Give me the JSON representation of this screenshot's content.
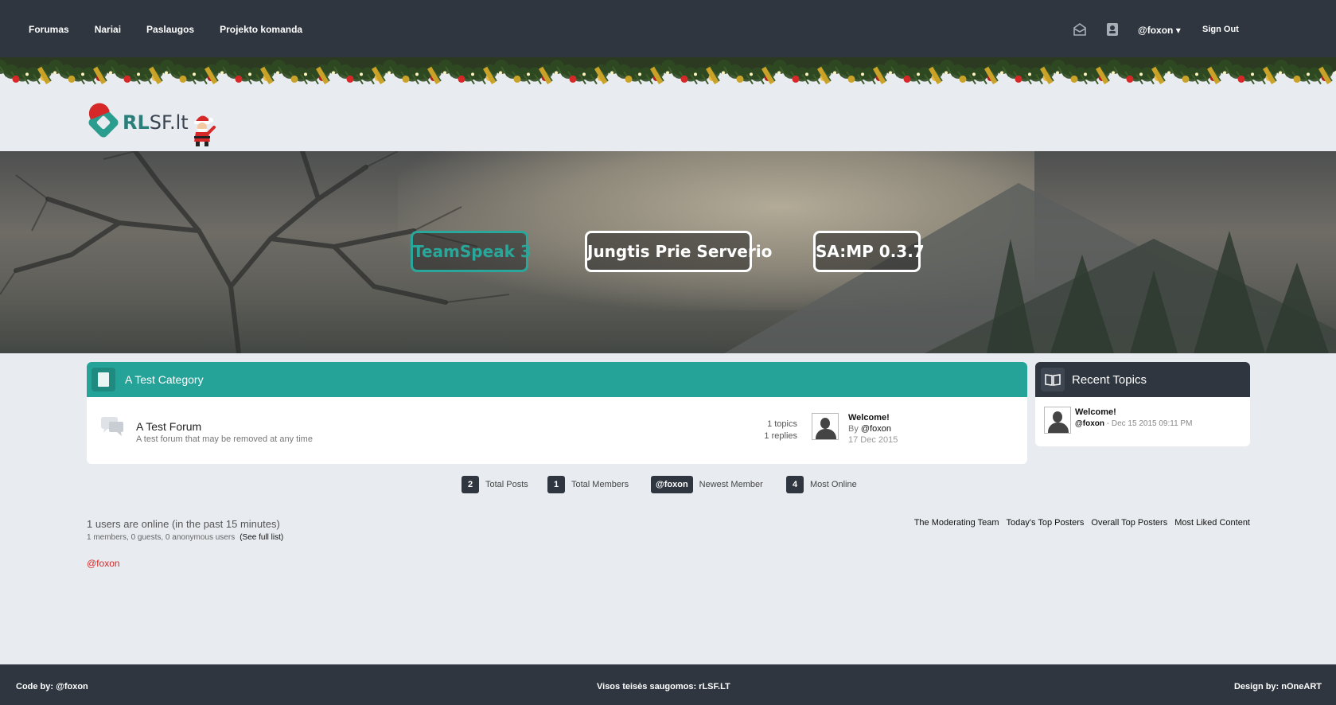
{
  "nav": {
    "items": [
      {
        "label": "Forumas"
      },
      {
        "label": "Nariai"
      },
      {
        "label": "Paslaugos"
      },
      {
        "label": "Projekto komanda"
      }
    ],
    "user": "@foxon",
    "signout": "Sign Out"
  },
  "logo": {
    "part1": "RL",
    "part2": "SF.lt"
  },
  "hero": {
    "buttons": [
      {
        "label": "TeamSpeak 3"
      },
      {
        "label": "Jungtis Prie Serverio"
      },
      {
        "label": "SA:MP 0.3.7"
      }
    ]
  },
  "category": {
    "title": "A Test Category",
    "forum": {
      "name": "A Test Forum",
      "description": "A test forum that may be removed at any time",
      "topics": "1 topics",
      "replies": "1 replies",
      "last_title": "Welcome!",
      "last_by_prefix": "By",
      "last_by_user": "@foxon",
      "last_date": "17 Dec 2015"
    }
  },
  "recent": {
    "title": "Recent Topics",
    "items": [
      {
        "title": "Welcome!",
        "user": "@foxon",
        "date": " - Dec 15 2015 09:11 PM"
      }
    ]
  },
  "stats": [
    {
      "value": "2",
      "label": "Total Posts"
    },
    {
      "value": "1",
      "label": "Total Members"
    },
    {
      "value": "@foxon",
      "label": "Newest Member"
    },
    {
      "value": "4",
      "label": "Most Online"
    }
  ],
  "online": {
    "title": "1 users are online (in the past 15 minutes)",
    "sub": "1 members, 0 guests, 0 anonymous users",
    "full_list": "(See full list)",
    "user": "@foxon"
  },
  "links": [
    "The Moderating Team",
    "Today's Top Posters",
    "Overall Top Posters",
    "Most Liked Content"
  ],
  "footer": {
    "left": "Code by: @foxon",
    "center": "Visos teisės saugomos: rLSF.LT",
    "right": "Design by: nOneART"
  },
  "colors": {
    "teal": "#25a398",
    "dark": "#2f3640",
    "online_user": "#d62828"
  }
}
